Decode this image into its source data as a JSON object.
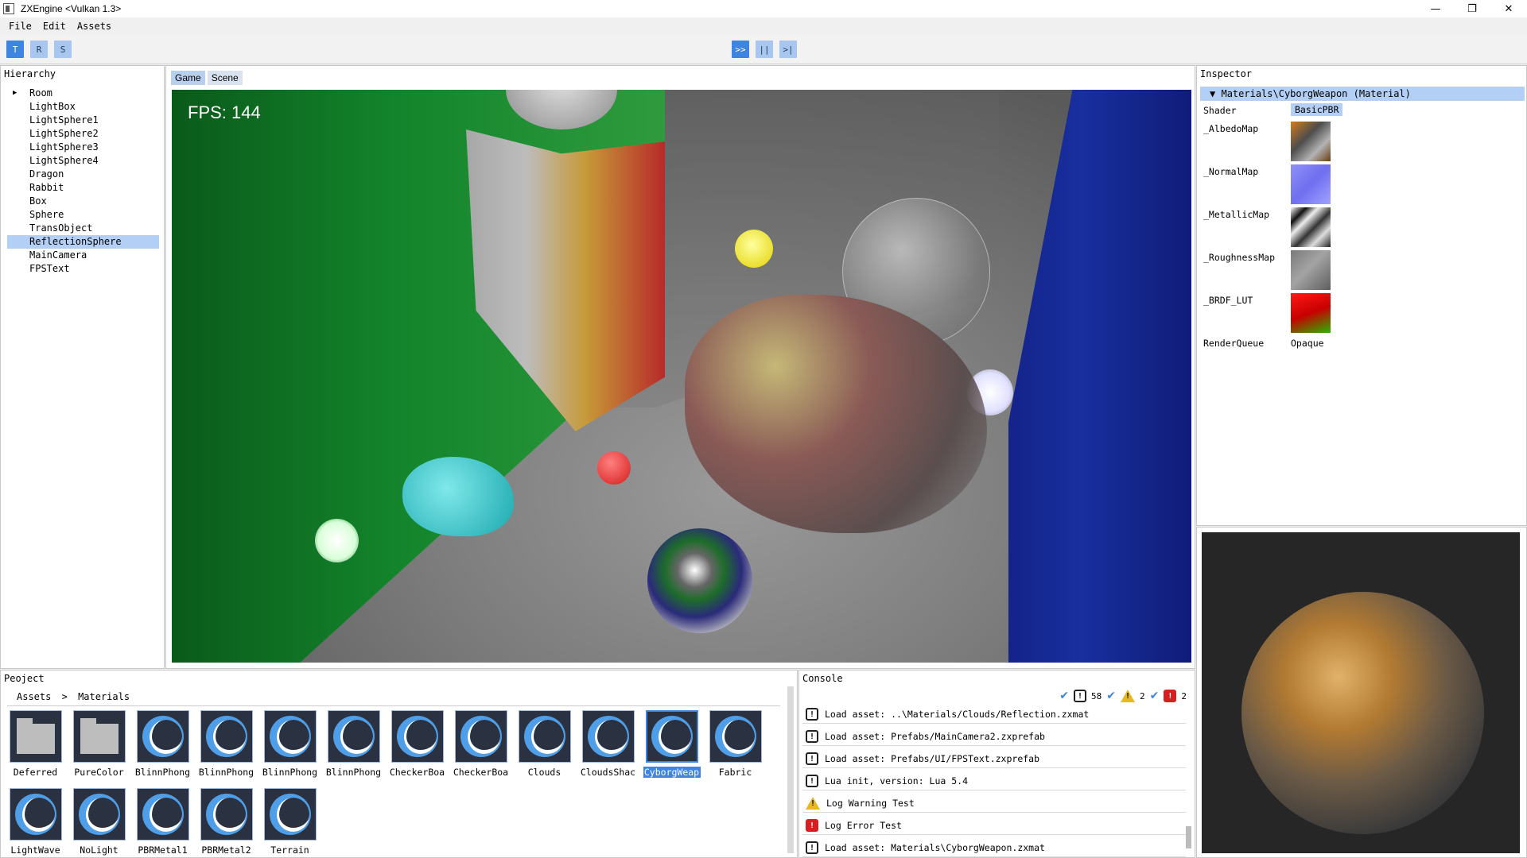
{
  "window": {
    "title": "ZXEngine <Vulkan 1.3>",
    "controls": [
      "—",
      "❐",
      "✕"
    ]
  },
  "menu": [
    "File",
    "Edit",
    "Assets"
  ],
  "toolbar": {
    "left": [
      "T",
      "R",
      "S"
    ],
    "center": [
      ">>",
      "||",
      ">|"
    ]
  },
  "hierarchy": {
    "title": "Hierarchy",
    "items": [
      "Room",
      "LightBox",
      "LightSphere1",
      "LightSphere2",
      "LightSphere3",
      "LightSphere4",
      "Dragon",
      "Rabbit",
      "Box",
      "Sphere",
      "TransObject",
      "ReflectionSphere",
      "MainCamera",
      "FPSText"
    ],
    "selected": "ReflectionSphere"
  },
  "viewport": {
    "tabs": [
      "Game",
      "Scene"
    ],
    "fps_text": "FPS: 144"
  },
  "inspector": {
    "title": "Inspector",
    "header": "Materials\\CyborgWeapon (Material)",
    "rows": {
      "shader_label": "Shader",
      "shader_value": "BasicPBR",
      "albedo": "_AlbedoMap",
      "normal": "_NormalMap",
      "metallic": "_MetallicMap",
      "roughness": "_RoughnessMap",
      "brdf": "_BRDF_LUT",
      "queue_label": "RenderQueue",
      "queue_value": "Opaque"
    }
  },
  "project": {
    "title": "Peoject",
    "breadcrumb": [
      "Assets",
      ">",
      "Materials"
    ],
    "assets": [
      {
        "name": "Deferred",
        "kind": "folder"
      },
      {
        "name": "PureColor",
        "kind": "folder"
      },
      {
        "name": "BlinnPhong",
        "kind": "material"
      },
      {
        "name": "BlinnPhong",
        "kind": "material"
      },
      {
        "name": "BlinnPhong",
        "kind": "material"
      },
      {
        "name": "BlinnPhong",
        "kind": "material"
      },
      {
        "name": "CheckerBoa",
        "kind": "material"
      },
      {
        "name": "CheckerBoa",
        "kind": "material"
      },
      {
        "name": "Clouds",
        "kind": "material"
      },
      {
        "name": "CloudsShac",
        "kind": "material"
      },
      {
        "name": "CyborgWeap",
        "kind": "material"
      },
      {
        "name": "Fabric",
        "kind": "material"
      },
      {
        "name": "LightWave",
        "kind": "material"
      },
      {
        "name": "NoLight",
        "kind": "material"
      },
      {
        "name": "PBRMetal1",
        "kind": "material"
      },
      {
        "name": "PBRMetal2",
        "kind": "material"
      },
      {
        "name": "Terrain",
        "kind": "material"
      }
    ],
    "selected_index": 10
  },
  "console": {
    "title": "Console",
    "counts": {
      "info": "58",
      "warning": "2",
      "error": "2"
    },
    "logs": [
      {
        "type": "info",
        "text": "Load asset: ..\\Materials/Clouds/Reflection.zxmat"
      },
      {
        "type": "info",
        "text": "Load asset: Prefabs/MainCamera2.zxprefab"
      },
      {
        "type": "info",
        "text": "Load asset: Prefabs/UI/FPSText.zxprefab"
      },
      {
        "type": "info",
        "text": "Lua init, version: Lua 5.4"
      },
      {
        "type": "warning",
        "text": "Log Warning Test"
      },
      {
        "type": "error",
        "text": "Log Error Test"
      },
      {
        "type": "info",
        "text": "Load asset: Materials\\CyborgWeapon.zxmat"
      }
    ]
  },
  "colors": {
    "accent": "#3d85e0",
    "selection": "#b4cff5",
    "warning": "#e9b71e",
    "error": "#d42020"
  }
}
